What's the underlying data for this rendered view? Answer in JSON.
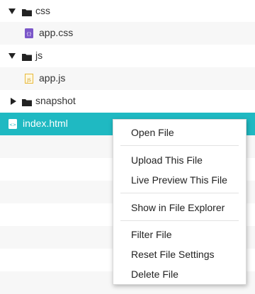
{
  "tree": {
    "items": [
      {
        "label": "css",
        "type": "folder",
        "expanded": true,
        "icon": "folder-icon"
      },
      {
        "label": "app.css",
        "type": "file",
        "icon": "css-file-icon"
      },
      {
        "label": "js",
        "type": "folder",
        "expanded": true,
        "icon": "folder-icon"
      },
      {
        "label": "app.js",
        "type": "file",
        "icon": "js-file-icon"
      },
      {
        "label": "snapshot",
        "type": "folder",
        "expanded": false,
        "icon": "folder-icon"
      },
      {
        "label": "index.html",
        "type": "file",
        "selected": true,
        "icon": "html-file-icon"
      }
    ]
  },
  "context_menu": {
    "items": [
      {
        "label": "Open File"
      },
      {
        "label": "Upload This File"
      },
      {
        "label": "Live Preview This File"
      },
      {
        "label": "Show in  File Explorer"
      },
      {
        "label": "Filter File"
      },
      {
        "label": "Reset File Settings"
      },
      {
        "label": "Delete File"
      }
    ]
  },
  "colors": {
    "selected_row": "#1fb9c2",
    "alt_row": "#f7f7f7",
    "css_icon": "#7b57c9",
    "js_icon": "#e8b93a"
  }
}
